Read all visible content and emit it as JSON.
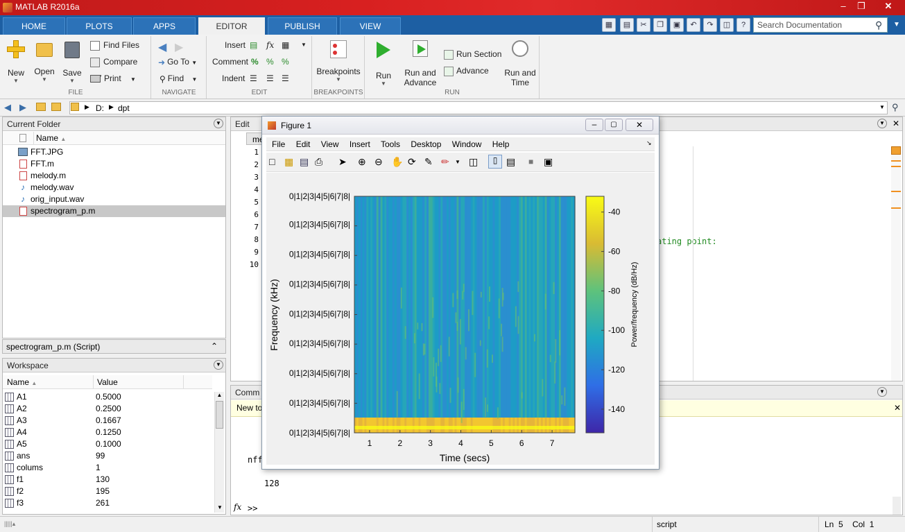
{
  "window": {
    "title": "MATLAB R2016a"
  },
  "tabs": [
    "HOME",
    "PLOTS",
    "APPS",
    "EDITOR",
    "PUBLISH",
    "VIEW"
  ],
  "search": {
    "placeholder": "Search Documentation"
  },
  "ribbon": {
    "file": {
      "new": "New",
      "open": "Open",
      "save": "Save",
      "find_files": "Find Files",
      "compare": "Compare",
      "print": "Print",
      "label": "FILE"
    },
    "navigate": {
      "goto": "Go To",
      "find": "Find",
      "label": "NAVIGATE"
    },
    "edit": {
      "insert": "Insert",
      "comment": "Comment",
      "indent": "Indent",
      "label": "EDIT"
    },
    "breakpoints": {
      "btn": "Breakpoints",
      "label": "BREAKPOINTS"
    },
    "run": {
      "run": "Run",
      "run_advance": "Run and Advance",
      "run_section": "Run Section",
      "advance": "Advance",
      "run_time": "Run and Time",
      "label": "RUN"
    }
  },
  "address": {
    "drive": "D:",
    "folder": "dpt"
  },
  "current_folder": {
    "title": "Current Folder",
    "col_name": "Name",
    "files": [
      "FFT.JPG",
      "FFT.m",
      "melody.m",
      "melody.wav",
      "orig_input.wav",
      "spectrogram_p.m"
    ],
    "details": "spectrogram_p.m  (Script)"
  },
  "workspace": {
    "title": "Workspace",
    "col_name": "Name",
    "col_value": "Value",
    "rows": [
      {
        "name": "A1",
        "value": "0.5000"
      },
      {
        "name": "A2",
        "value": "0.2500"
      },
      {
        "name": "A3",
        "value": "0.1667"
      },
      {
        "name": "A4",
        "value": "0.1250"
      },
      {
        "name": "A5",
        "value": "0.1000"
      },
      {
        "name": "ans",
        "value": "99"
      },
      {
        "name": "colums",
        "value": "1"
      },
      {
        "name": "f1",
        "value": "130"
      },
      {
        "name": "f2",
        "value": "195"
      },
      {
        "name": "f3",
        "value": "261"
      }
    ]
  },
  "editor": {
    "title": "Edit",
    "tab": "me",
    "line_numbers": [
      "1",
      "2",
      "3",
      "4",
      "5",
      "6",
      "7",
      "8",
      "9",
      "10"
    ],
    "visible_text": "ating point:"
  },
  "command": {
    "title": "Comm",
    "banner": "New to",
    "lines": [
      "nff",
      "128"
    ],
    "prompt": ">>"
  },
  "figure": {
    "title": "Figure 1",
    "menus": [
      "File",
      "Edit",
      "View",
      "Insert",
      "Tools",
      "Desktop",
      "Window",
      "Help"
    ]
  },
  "chart_data": {
    "type": "heatmap",
    "xlabel": "Time (secs)",
    "ylabel": "Frequency (kHz)",
    "x_ticks": [
      1,
      2,
      3,
      4,
      5,
      6,
      7
    ],
    "y_tick_label": "0|1|2|3|4|5|6|7|8|",
    "y_tick_count": 9,
    "colorbar_label": "Power/frequency (dB/Hz)",
    "colorbar_ticks": [
      -40,
      -60,
      -80,
      -100,
      -120,
      -140
    ],
    "colorbar_range": [
      -152,
      -32
    ],
    "colors": {
      "low": "#3e26a8",
      "mid": "#1fa9c2",
      "high": "#f9fb15"
    }
  },
  "status": {
    "mode": "script",
    "ln_label": "Ln",
    "ln": "5",
    "col_label": "Col",
    "col": "1"
  }
}
